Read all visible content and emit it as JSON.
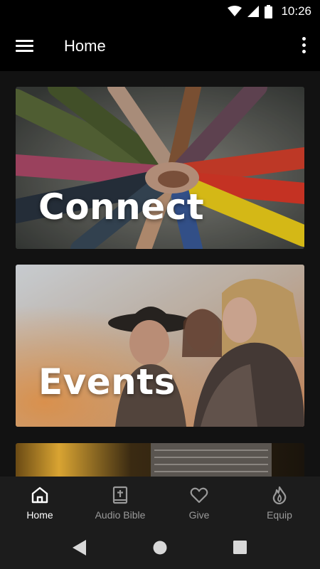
{
  "status_bar": {
    "time": "10:26",
    "icons": [
      "wifi-icon",
      "signal-icon",
      "battery-icon"
    ]
  },
  "app_bar": {
    "title": "Home",
    "menu_icon": "hamburger-menu-icon",
    "overflow_icon": "more-vert-icon"
  },
  "cards": [
    {
      "label": "Connect",
      "image": "hands-together-photo"
    },
    {
      "label": "Events",
      "image": "friends-laughing-photo"
    },
    {
      "label": "",
      "image": "microphone-stage-photo"
    }
  ],
  "bottom_nav": {
    "items": [
      {
        "label": "Home",
        "icon": "home-icon",
        "active": true
      },
      {
        "label": "Audio Bible",
        "icon": "bible-icon",
        "active": false
      },
      {
        "label": "Give",
        "icon": "heart-icon",
        "active": false
      },
      {
        "label": "Equip",
        "icon": "flame-icon",
        "active": false
      }
    ]
  },
  "system_nav": [
    "back-icon",
    "home-circle-icon",
    "recents-icon"
  ],
  "colors": {
    "background": "#121212",
    "bar": "#000000",
    "nav_bg": "#1c1c1c",
    "inactive": "#9a9a9a",
    "active": "#ffffff"
  }
}
